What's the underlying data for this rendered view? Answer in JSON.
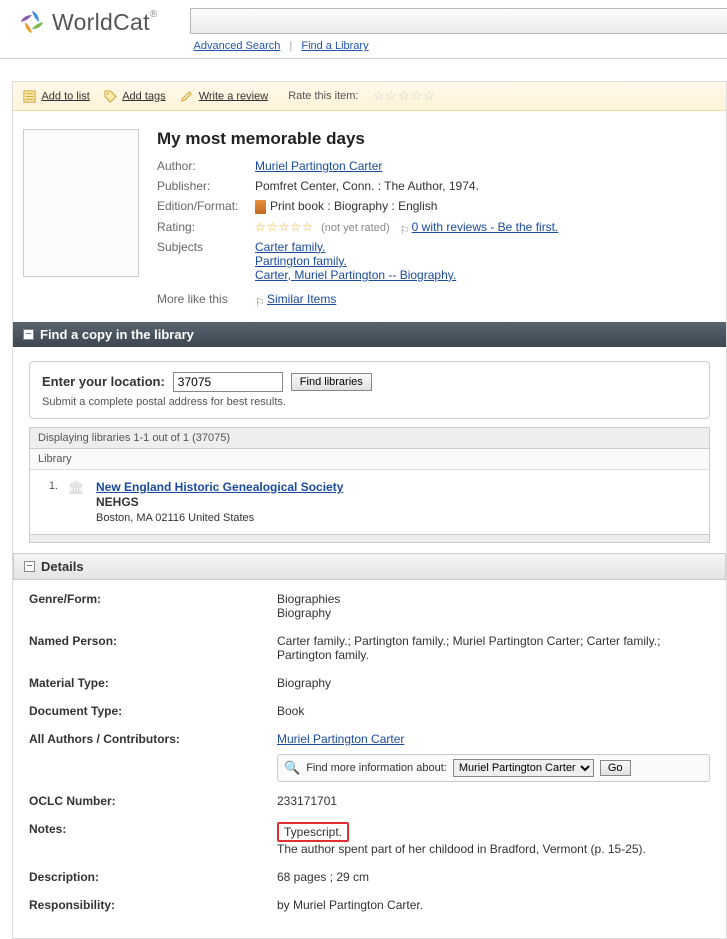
{
  "brand": "WorldCat",
  "search_links": {
    "advanced": "Advanced Search",
    "find_library": "Find a Library"
  },
  "actions": {
    "add_list": "Add to list",
    "add_tags": "Add tags",
    "write_review": "Write a review",
    "rate_label": "Rate this item:"
  },
  "item": {
    "title": "My most memorable days",
    "author_label": "Author:",
    "author": "Muriel Partington Carter",
    "publisher_label": "Publisher:",
    "publisher": "Pomfret Center, Conn. : The Author, 1974.",
    "format_label": "Edition/Format:",
    "format": "Print book : Biography : English",
    "rating_label": "Rating:",
    "rating_text": "(not yet rated)",
    "reviews_link": "0 with reviews - Be the first.",
    "subjects_label": "Subjects",
    "subjects": [
      "Carter family.",
      "Partington family.",
      "Carter, Muriel Partington -- Biography."
    ],
    "more_like_label": "More like this",
    "similar": "Similar Items"
  },
  "library_section": {
    "title": "Find a copy in the library",
    "enter_label": "Enter your location:",
    "input_value": "37075",
    "btn": "Find libraries",
    "hint": "Submit a complete postal address for best results.",
    "displaying": "Displaying libraries 1-1 out of 1 (37075)",
    "col_library": "Library",
    "result": {
      "num": "1.",
      "name": "New England Historic Genealogical Society",
      "code": "NEHGS",
      "addr": "Boston, MA 02116 United States"
    }
  },
  "details_section": {
    "title": "Details",
    "rows": {
      "genre_label": "Genre/Form:",
      "genre_1": "Biographies",
      "genre_2": "Biography",
      "named_label": "Named Person:",
      "named": "Carter family.; Partington family.; Muriel Partington Carter; Carter family.; Partington family.",
      "material_label": "Material Type:",
      "material": "Biography",
      "doctype_label": "Document Type:",
      "doctype": "Book",
      "authors_label": "All Authors / Contributors:",
      "authors": "Muriel Partington Carter",
      "find_more": "Find more information about:",
      "find_more_opt": "Muriel Partington Carter",
      "go": "Go",
      "oclc_label": "OCLC Number:",
      "oclc": "233171701",
      "notes_label": "Notes:",
      "notes_hl": "Typescript.",
      "notes_2": "The author spent part of her childood in Bradford, Vermont (p. 15-25).",
      "desc_label": "Description:",
      "desc": "68 pages ; 29 cm",
      "resp_label": "Responsibility:",
      "resp": "by Muriel Partington Carter."
    }
  }
}
